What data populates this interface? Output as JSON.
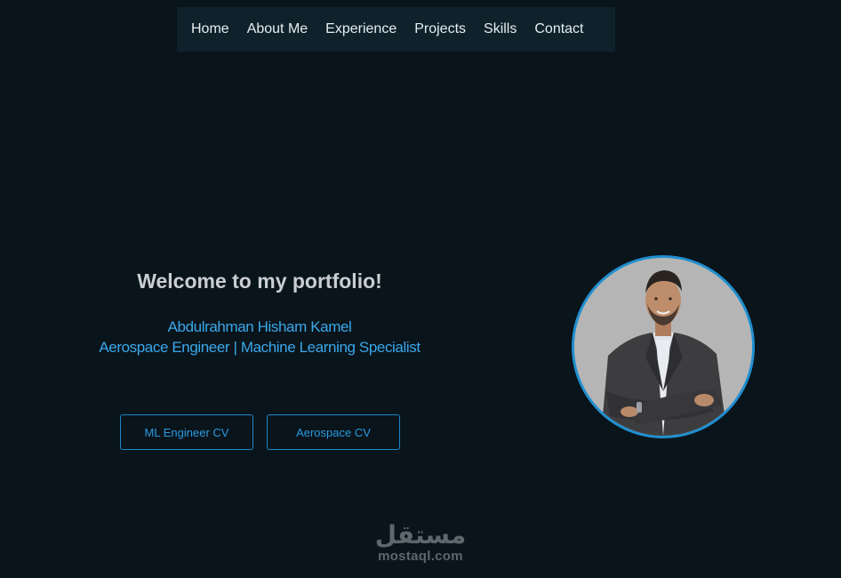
{
  "nav": {
    "items": [
      {
        "label": "Home"
      },
      {
        "label": "About Me"
      },
      {
        "label": "Experience"
      },
      {
        "label": "Projects"
      },
      {
        "label": "Skills"
      },
      {
        "label": "Contact"
      }
    ]
  },
  "hero": {
    "welcome": "Welcome to my portfolio!",
    "name": "Abdulrahman Hisham Kamel",
    "role": "Aerospace Engineer | Machine Learning Specialist"
  },
  "buttons": {
    "ml_cv": "ML Engineer CV",
    "aerospace_cv": "Aerospace CV"
  },
  "profile": {
    "icon": "profile-photo"
  },
  "watermark": {
    "logo": "مستقل",
    "url": "mostaql.com"
  },
  "colors": {
    "background": "#0a141b",
    "navbar": "#0f222c",
    "accent": "#2a9be0",
    "heading": "#c9ced1"
  }
}
